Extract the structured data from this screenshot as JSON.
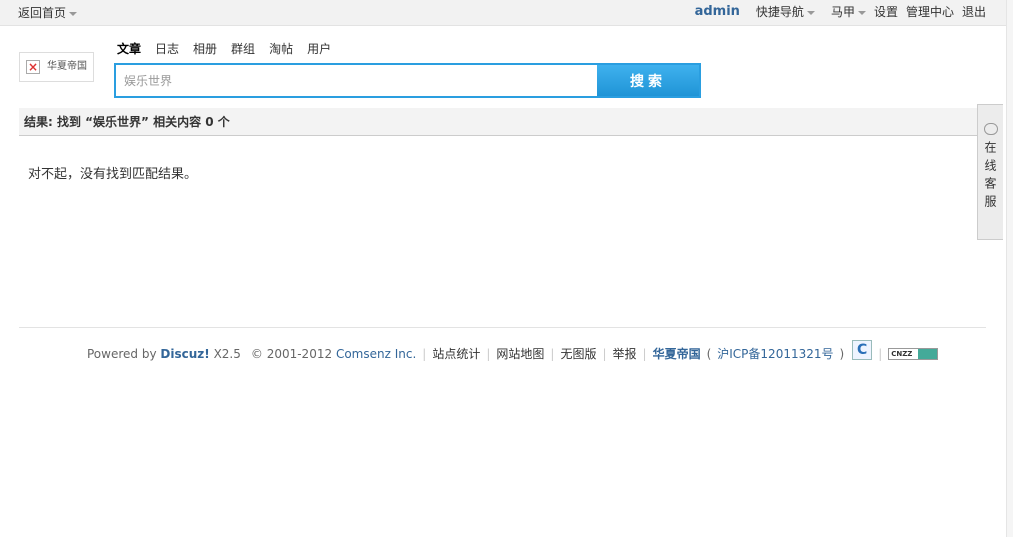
{
  "topbar": {
    "home_label": "返回首页",
    "user": "admin",
    "quick_nav": "快捷导航",
    "member": "马甲",
    "settings": "设置",
    "admin_center": "管理中心",
    "logout": "退出"
  },
  "logo": {
    "alt": "华夏帝国"
  },
  "search": {
    "tabs": [
      "文章",
      "日志",
      "相册",
      "群组",
      "淘帖",
      "用户"
    ],
    "active_tab": "文章",
    "value": "娱乐世界",
    "button": "搜索"
  },
  "result": {
    "header": "结果: 找到 “娱乐世界” 相关内容 0 个",
    "empty_message": "对不起，没有找到匹配结果。"
  },
  "footer": {
    "powered_prefix": "Powered by",
    "brand": "Discuz!",
    "version": "X2.5",
    "copyright": "© 2001-2012",
    "company": "Comsenz Inc.",
    "links": [
      "站点统计",
      "网站地图",
      "无图版",
      "举报"
    ],
    "site_name": "华夏帝国",
    "icp_open": "(",
    "icp": "沪ICP备12011321号",
    "icp_close": ")",
    "cnzz": "CNZZ"
  },
  "side_service": {
    "label": "在线客服"
  },
  "colors": {
    "accent": "#2a9ee0",
    "link": "#336699"
  }
}
